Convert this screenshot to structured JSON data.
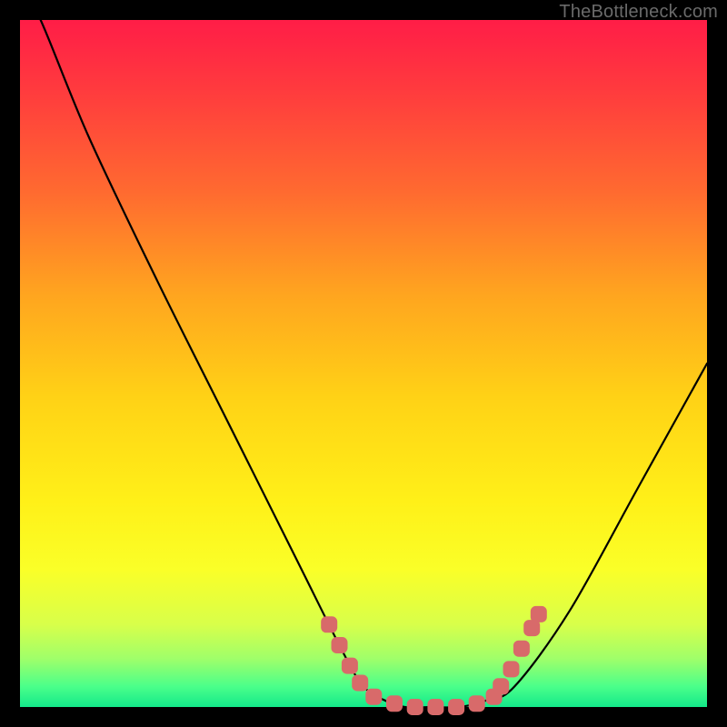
{
  "watermark": "TheBottleneck.com",
  "chart_data": {
    "type": "line",
    "title": "",
    "xlabel": "",
    "ylabel": "",
    "xlim": [
      0,
      100
    ],
    "ylim": [
      0,
      100
    ],
    "grid": false,
    "legend": false,
    "series": [
      {
        "name": "bottleneck-curve",
        "color": "#000000",
        "x": [
          0,
          3,
          10,
          20,
          30,
          40,
          47,
          50,
          53,
          56,
          60,
          64,
          68,
          72,
          80,
          90,
          100
        ],
        "y": [
          105,
          100,
          83,
          62,
          42,
          22,
          8,
          3,
          1,
          0,
          0,
          0,
          1,
          3,
          14,
          32,
          50
        ]
      }
    ],
    "markers": {
      "name": "highlight-dots",
      "color": "#d86a6a",
      "radius_px": 9,
      "points": [
        {
          "x": 45.0,
          "y": 12.0
        },
        {
          "x": 46.5,
          "y": 9.0
        },
        {
          "x": 48.0,
          "y": 6.0
        },
        {
          "x": 49.5,
          "y": 3.5
        },
        {
          "x": 51.5,
          "y": 1.5
        },
        {
          "x": 54.5,
          "y": 0.5
        },
        {
          "x": 57.5,
          "y": 0.0
        },
        {
          "x": 60.5,
          "y": 0.0
        },
        {
          "x": 63.5,
          "y": 0.0
        },
        {
          "x": 66.5,
          "y": 0.5
        },
        {
          "x": 69.0,
          "y": 1.5
        },
        {
          "x": 70.0,
          "y": 3.0
        },
        {
          "x": 71.5,
          "y": 5.5
        },
        {
          "x": 73.0,
          "y": 8.5
        },
        {
          "x": 74.5,
          "y": 11.5
        },
        {
          "x": 75.5,
          "y": 13.5
        }
      ]
    },
    "background": {
      "type": "vertical-gradient",
      "stops": [
        {
          "pos": 0.0,
          "color": "#ff1d47"
        },
        {
          "pos": 0.25,
          "color": "#ff6a30"
        },
        {
          "pos": 0.55,
          "color": "#ffd216"
        },
        {
          "pos": 0.8,
          "color": "#faff28"
        },
        {
          "pos": 0.97,
          "color": "#4bff8a"
        },
        {
          "pos": 1.0,
          "color": "#13e98a"
        }
      ]
    }
  }
}
